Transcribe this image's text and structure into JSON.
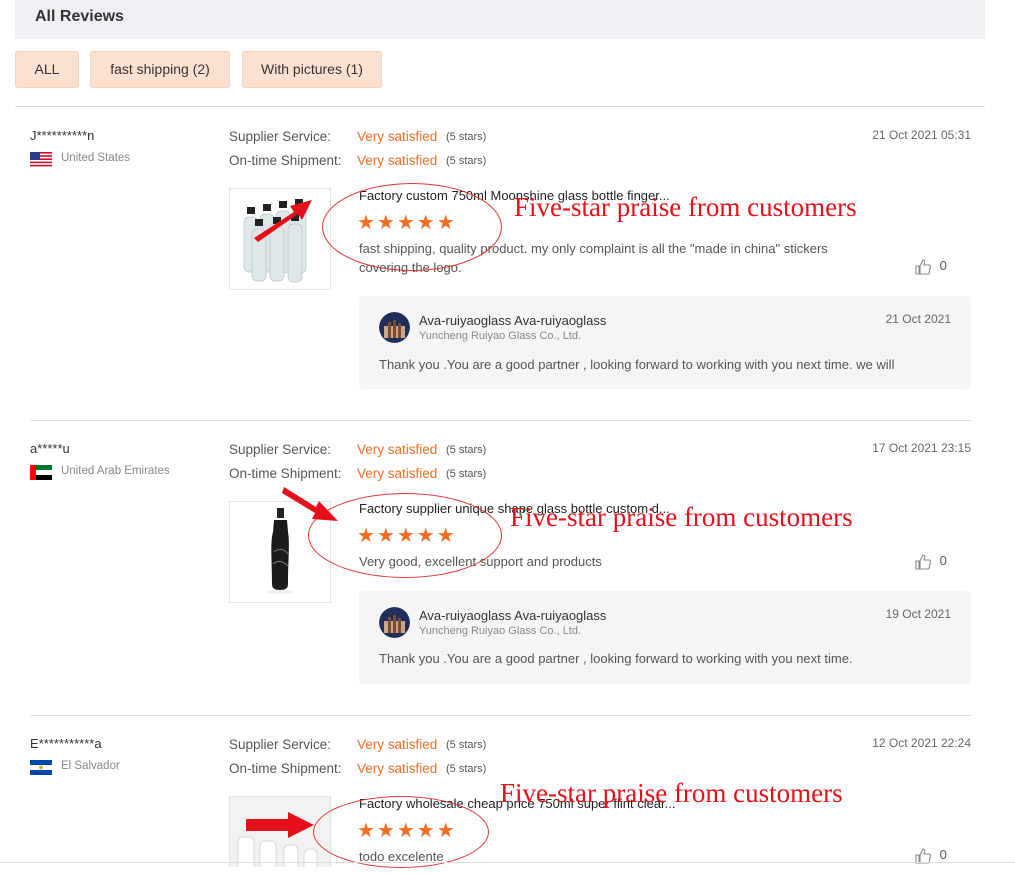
{
  "header": {
    "title": "All Reviews"
  },
  "filters": [
    {
      "label": "ALL"
    },
    {
      "label": "fast shipping (2)"
    },
    {
      "label": "With pictures (1)"
    }
  ],
  "labels": {
    "supplier_service": "Supplier Service:",
    "ontime_shipment": "On-time Shipment:"
  },
  "reviews": [
    {
      "user": "J**********n",
      "country": "United States",
      "flag": "us-flag-icon",
      "date": "21 Oct 2021 05:31",
      "supplier_value": "Very satisfied",
      "supplier_stars": "(5 stars)",
      "shipment_value": "Very satisfied",
      "shipment_stars": "(5 stars)",
      "product_title": "Factory custom 750ml Moonshine glass bottle finger...",
      "stars": "★★★★★",
      "text": "fast shipping, quality product. my only complaint is all the \"made in china\" stickers covering the logo.",
      "likes": "0",
      "reply": {
        "name": "Ava-ruiyaoglass Ava-ruiyaoglass",
        "company": "Yuncheng Ruiyao Glass Co., Ltd.",
        "date": "21 Oct 2021",
        "message": "Thank you .You are a good partner ,  looking forward to working with you next time. we will"
      },
      "annotation": "Five-star praise from customers"
    },
    {
      "user": "a*****u",
      "country": "United Arab Emirates",
      "flag": "uae-flag-icon",
      "date": "17 Oct 2021 23:15",
      "supplier_value": "Very satisfied",
      "supplier_stars": "(5 stars)",
      "shipment_value": "Very satisfied",
      "shipment_stars": "(5 stars)",
      "product_title": "Factory supplier unique shape glass bottle custom d...",
      "stars": "★★★★★",
      "text": "Very good, excellent support and products",
      "likes": "0",
      "reply": {
        "name": "Ava-ruiyaoglass Ava-ruiyaoglass",
        "company": "Yuncheng Ruiyao Glass Co., Ltd.",
        "date": "19 Oct 2021",
        "message": "Thank you .You are a good partner ,  looking forward to working with you next time."
      },
      "annotation": "Five-star praise from customers"
    },
    {
      "user": "E***********a",
      "country": "El Salvador",
      "flag": "el-salvador-flag-icon",
      "date": "12 Oct 2021 22:24",
      "supplier_value": "Very satisfied",
      "supplier_stars": "(5 stars)",
      "shipment_value": "Very satisfied",
      "shipment_stars": "(5 stars)",
      "product_title": "Factory wholesale cheap price 750ml super flint clear...",
      "stars": "★★★★★",
      "text": "todo excelente",
      "likes": "0",
      "annotation": "Five-star praise from customers"
    }
  ],
  "colors": {
    "accent": "#f26c21",
    "annotation": "#e5101a",
    "filter_bg": "#fce1d0"
  }
}
